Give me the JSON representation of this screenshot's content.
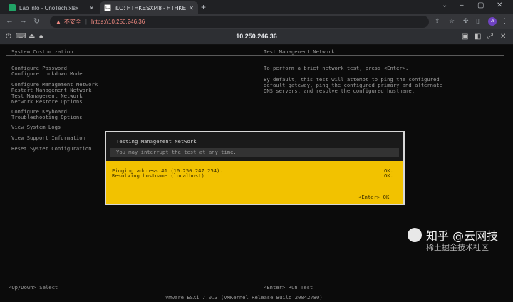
{
  "browser": {
    "tabs": [
      {
        "title": "Lab info - UnoTech.xlsx",
        "favicon": "excel-icon"
      },
      {
        "title": "iLO: HTHKESXI48 - HTHKESXI4",
        "favicon": "ilo-icon"
      }
    ],
    "new_tab": "+",
    "address": {
      "security_label": "不安全",
      "url": "https://10.250.246.36"
    },
    "profile_initial": "Ji"
  },
  "ilo": {
    "host": "10.250.246.36"
  },
  "console": {
    "left_header": "System Customization",
    "right_header": "Test Management Network",
    "menu": [
      "Configure Password",
      "Configure Lockdown Mode",
      "Configure Management Network",
      "Restart Management Network",
      "Test Management Network",
      "Network Restore Options",
      "Configure Keyboard",
      "Troubleshooting Options",
      "View System Logs",
      "View Support Information",
      "Reset System Configuration"
    ],
    "description": [
      "To perform a brief network test, press <Enter>.",
      "By default, this test will attempt to ping the configured",
      "default gateway, ping the configured primary and alternate",
      "DNS servers, and resolve the configured hostname."
    ],
    "footer_left": "<Up/Down> Select",
    "footer_right": "<Enter> Run Test",
    "version": "VMware ESXi 7.0.3 (VMKernel Release Build 20042780)"
  },
  "dialog": {
    "title": "Testing Management Network",
    "subtitle": "You may interrupt the test at any time.",
    "results": [
      {
        "label": "Pinging address #1 (10.250.247.254).",
        "status": "OK."
      },
      {
        "label": "Resolving hostname (localhost).",
        "status": "OK."
      }
    ],
    "enter_label": "<Enter>",
    "ok_label": "OK"
  },
  "watermark": {
    "line1": "知乎 @云网技",
    "line2": "稀土掘金技术社区"
  },
  "colors": {
    "dialog_bg": "#f2c200",
    "console_bg": "#0b0b0b",
    "console_text": "#9a9a9a"
  }
}
